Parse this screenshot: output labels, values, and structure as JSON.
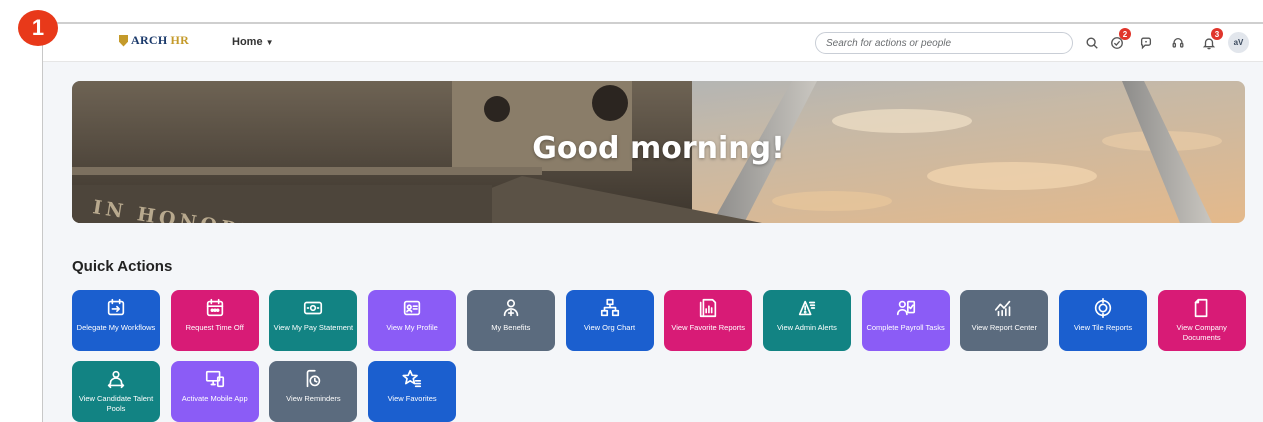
{
  "step_badge": "1",
  "header": {
    "logo": {
      "arch": "ARCH",
      "hr": "HR"
    },
    "home_menu": "Home",
    "search_placeholder": "Search for actions or people",
    "badges": {
      "approvals": "2",
      "notifications": "3"
    },
    "avatar_initials": "aV"
  },
  "hero": {
    "greeting": "Good morning!",
    "carved_text": "IN HONOREM"
  },
  "quick_actions": {
    "title": "Quick Actions",
    "tiles": [
      {
        "label": "Delegate My Workflows",
        "icon": "delegate-workflow-icon",
        "color": "#1b5fcf"
      },
      {
        "label": "Request Time Off",
        "icon": "calendar-icon",
        "color": "#d81b76"
      },
      {
        "label": "View My Pay Statement",
        "icon": "money-icon",
        "color": "#128383"
      },
      {
        "label": "View My Profile",
        "icon": "id-card-icon",
        "color": "#8b5cf6"
      },
      {
        "label": "My Benefits",
        "icon": "benefits-person-icon",
        "color": "#5b6b7e"
      },
      {
        "label": "View Org Chart",
        "icon": "org-chart-icon",
        "color": "#1b5fcf"
      },
      {
        "label": "View Favorite Reports",
        "icon": "favorite-report-icon",
        "color": "#d81b76"
      },
      {
        "label": "View Admin Alerts",
        "icon": "alert-list-icon",
        "color": "#128383"
      },
      {
        "label": "Complete Payroll Tasks",
        "icon": "payroll-tasks-icon",
        "color": "#8b5cf6"
      },
      {
        "label": "View Report Center",
        "icon": "report-chart-icon",
        "color": "#5b6b7e"
      },
      {
        "label": "View Tile Reports",
        "icon": "target-icon",
        "color": "#1b5fcf"
      },
      {
        "label": "View Company Documents",
        "icon": "document-icon",
        "color": "#d81b76"
      },
      {
        "label": "View Candidate Talent Pools",
        "icon": "talent-pool-icon",
        "color": "#128383"
      },
      {
        "label": "Activate Mobile App",
        "icon": "mobile-device-icon",
        "color": "#8b5cf6"
      },
      {
        "label": "View Reminders",
        "icon": "reminder-clock-icon",
        "color": "#5b6b7e"
      },
      {
        "label": "View Favorites",
        "icon": "star-list-icon",
        "color": "#1b5fcf"
      }
    ]
  }
}
